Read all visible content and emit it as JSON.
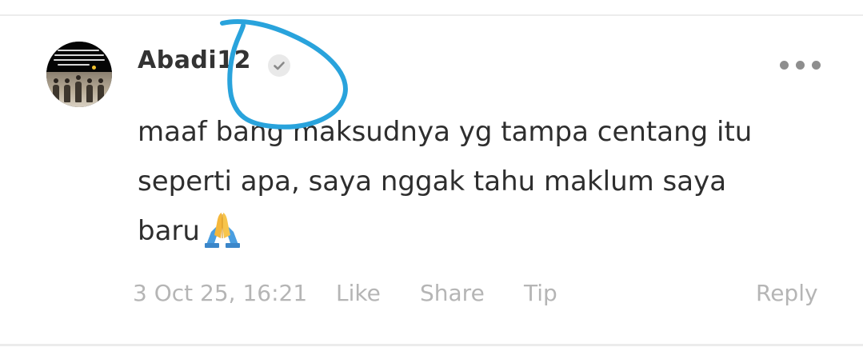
{
  "comment": {
    "username": "Abadi12",
    "verified_icon": "check-badge-icon",
    "more_icon": "more-dots-icon",
    "text_lines": [
      "maaf bang maksudnya yg tampa centang itu",
      "seperti apa, saya nggak tahu maklum saya",
      "baru"
    ],
    "trailing_emoji": "folded-hands-emoji",
    "timestamp": "3 Oct 25, 16:21",
    "actions": {
      "like": "Like",
      "share": "Share",
      "tip": "Tip",
      "reply": "Reply"
    }
  },
  "colors": {
    "username": "#333333",
    "comment_text": "#2e2e2e",
    "meta_text": "#b5b5b5",
    "annotation_stroke": "#29a3dc",
    "divider": "#ececec"
  }
}
